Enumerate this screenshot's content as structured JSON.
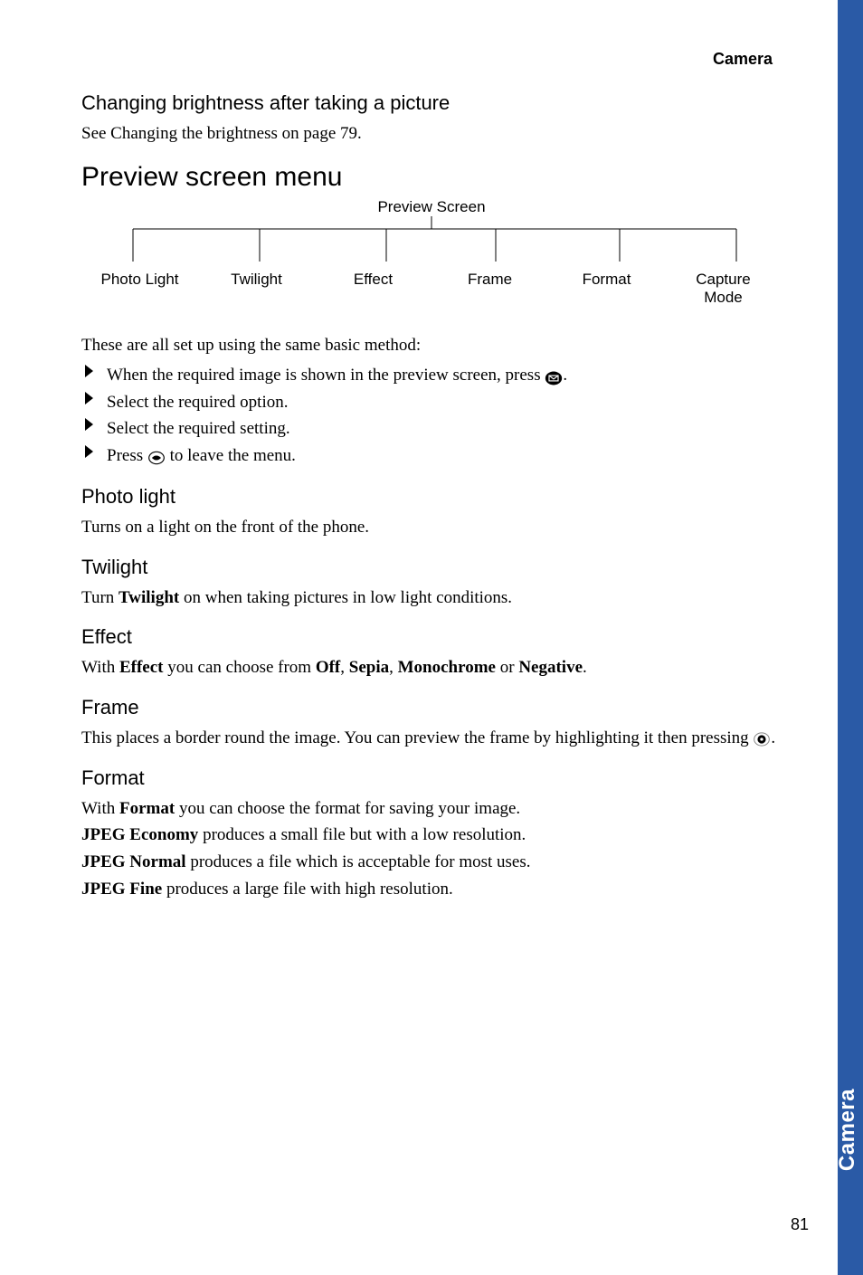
{
  "header": "Camera",
  "section_brightness": {
    "title": "Changing brightness after taking a picture",
    "text": "See Changing the brightness on page 79."
  },
  "preview_menu": {
    "title": "Preview screen menu",
    "tree": {
      "root": "Preview Screen",
      "leaves": [
        "Photo Light",
        "Twilight",
        "Effect",
        "Frame",
        "Format",
        "Capture\nMode"
      ]
    },
    "intro": "These are all set up using the same basic method:",
    "bullets": [
      {
        "text_before": "When the required image is shown in the preview screen, press ",
        "icon": "envelope",
        "text_after": "."
      },
      {
        "text_before": "Select the required option.",
        "icon": null,
        "text_after": ""
      },
      {
        "text_before": "Select the required setting.",
        "icon": null,
        "text_after": ""
      },
      {
        "text_before": "Press ",
        "icon": "back",
        "text_after": " to leave the menu."
      }
    ]
  },
  "photo_light": {
    "title": "Photo light",
    "text": "Turns on a light on the front of the phone."
  },
  "twilight": {
    "title": "Twilight",
    "text_before": "Turn ",
    "bold": "Twilight",
    "text_after": " on when taking pictures in low light conditions."
  },
  "effect": {
    "title": "Effect",
    "text_before": "With ",
    "b1": "Effect",
    "t2": " you can choose from ",
    "b2": "Off",
    "t3": ", ",
    "b3": "Sepia",
    "t4": ", ",
    "b4": "Monochrome",
    "t5": " or ",
    "b5": "Negative",
    "t6": "."
  },
  "frame": {
    "title": "Frame",
    "text_before": "This places a border round the image. You can preview the frame by highlighting it then pressing ",
    "text_after": "."
  },
  "format": {
    "title": "Format",
    "line1_before": "With ",
    "line1_bold": "Format",
    "line1_after": " you can choose the format for saving your image.",
    "line2_bold": "JPEG Economy",
    "line2_after": " produces a small file but with a low resolution.",
    "line3_bold": "JPEG Normal",
    "line3_after": " produces a file which is acceptable for most uses.",
    "line4_bold": "JPEG Fine",
    "line4_after": " produces a large file with high resolution."
  },
  "side_tab": "Camera",
  "page_number": "81"
}
